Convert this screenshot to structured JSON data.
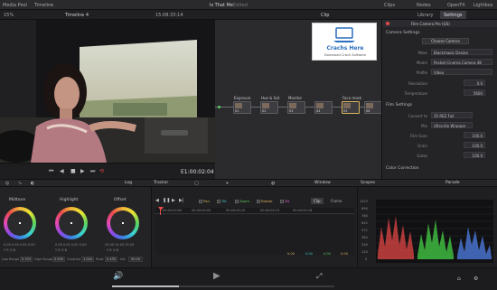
{
  "menu": {
    "media_pool": "Media Pool",
    "timeline": "Timeline",
    "project_name": "Is That Me",
    "edited": "Edited",
    "clips": "Clips",
    "nodes": "Nodes",
    "openfx": "OpenFX",
    "lightbox": "Lightbox"
  },
  "viewer_bar": {
    "zoom": "15%",
    "timeline_name": "Timeline 4",
    "timecode": "15:08:33:14",
    "clip_label": "Clip"
  },
  "inspector_bar": {
    "library_tab": "Library",
    "settings_tab": "Settings",
    "title": "Film Camera Pro (QS)"
  },
  "watermark": {
    "title": "Crachs Here",
    "subtitle": "Download Crack Software"
  },
  "viewer": {
    "timecode": "E1:00:02:04"
  },
  "nodes": [
    {
      "label": "Exposure",
      "num": "01"
    },
    {
      "label": "Hue & Sat",
      "num": "02"
    },
    {
      "label": "Monitor",
      "num": "03"
    },
    {
      "label": "",
      "num": "04"
    },
    {
      "label": "Face mask",
      "num": "05"
    },
    {
      "label": "",
      "num": "06"
    }
  ],
  "settings": {
    "camera_section": "Camera Settings",
    "choose_camera": "Choose Camera",
    "rows": [
      {
        "label": "Make",
        "value": "Blackmagic Design"
      },
      {
        "label": "Model",
        "value": "Pocket Cinema Camera 4K"
      },
      {
        "label": "Profile",
        "value": "Video"
      },
      {
        "label": "Resolution",
        "value": "0.0"
      },
      {
        "label": "Temperature",
        "value": "5600"
      }
    ],
    "film_section": "Film Settings",
    "film_rows": [
      {
        "label": "Convert to",
        "value": "35 REZ Full"
      },
      {
        "label": "Mix",
        "value": "Ultra-Vio Wrapper"
      },
      {
        "label": "Film Scan",
        "value": "100.0"
      },
      {
        "label": "Grain",
        "value": "100.0"
      },
      {
        "label": "Gates",
        "value": "100.0"
      }
    ],
    "color_section": "Color Correction"
  },
  "wheels": {
    "panel_label": "Log",
    "items": [
      {
        "name": "Midtone",
        "values": [
          "0.00",
          "0.00",
          "0.00",
          "0.00"
        ],
        "labels": [
          "Y",
          "R",
          "G",
          "B"
        ]
      },
      {
        "name": "Highlight",
        "values": [
          "0.00",
          "0.00",
          "0.00",
          "0.00"
        ],
        "labels": [
          "Y",
          "R",
          "G",
          "B"
        ]
      },
      {
        "name": "Offset",
        "values": [
          "25.00",
          "25.00",
          "25.00",
          "25.00"
        ],
        "labels": [
          "Y",
          "R",
          "G",
          "B"
        ]
      }
    ],
    "footer": {
      "low_range": "Low Range",
      "low_val": "0.333",
      "high_range": "High Range",
      "high_val": "0.550",
      "contrast": "Contrast",
      "contrast_val": "1.000",
      "pivot": "Pivot",
      "pivot_val": "0.435",
      "sat": "Sat",
      "sat_val": "50.00"
    }
  },
  "tracker": {
    "title": "Tracker",
    "window": "Window",
    "clip": "Clip",
    "frame": "Frame",
    "checks": [
      "Pan",
      "Tilt",
      "Zoom",
      "Rotate",
      "3D"
    ],
    "ruler": [
      "00:00:00:00",
      "00:00:00:00",
      "00:00:00:10",
      "00:00:00:13",
      "00:00:00:16"
    ],
    "readout": [
      "0.00",
      "0.00",
      "0.00",
      "0.00"
    ]
  },
  "scopes": {
    "title": "Scopes",
    "mode": "Parade",
    "scale": [
      "1023",
      "896",
      "768",
      "640",
      "512",
      "384",
      "256",
      "128",
      "0"
    ]
  },
  "colors": {
    "accent": "#e64a4a",
    "parade_red": "#e04545",
    "parade_green": "#45d045",
    "parade_blue": "#4f7fe6"
  }
}
